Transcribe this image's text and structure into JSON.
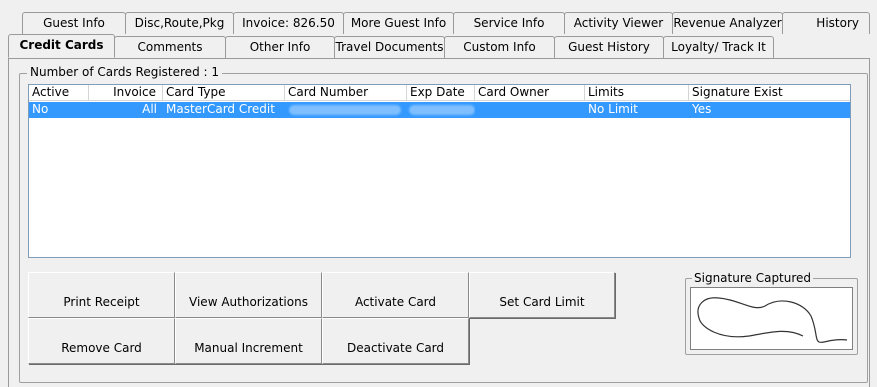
{
  "tabs_top": [
    "Guest Info",
    "Disc,Route,Pkg",
    "Invoice: 826.50",
    "More Guest Info",
    "Service Info",
    "Activity Viewer",
    "Revenue Analyzer",
    "History"
  ],
  "tabs_bottom": [
    "Credit Cards",
    "Comments",
    "Other Info",
    "Travel Documents",
    "Custom Info",
    "Guest History",
    "Loyalty/ Track It"
  ],
  "active_tab": "Credit Cards",
  "group_label": "Number of Cards Registered : 1",
  "table": {
    "columns": [
      "Active",
      "Invoice",
      "Card Type",
      "Card Number",
      "Exp Date",
      "Card Owner",
      "Limits",
      "Signature Exist"
    ],
    "rows": [
      [
        "No",
        "All",
        "MasterCard Credit",
        "",
        "",
        "",
        "No Limit",
        "Yes"
      ]
    ],
    "selected_row_color": "#3399ff"
  },
  "buttons": {
    "print_receipt": "Print Receipt",
    "view_authorizations": "View Authorizations",
    "activate_card": "Activate Card",
    "set_card_limit": "Set Card Limit",
    "remove_card": "Remove Card",
    "manual_increment": "Manual Increment",
    "deactivate_card": "Deactivate Card"
  },
  "signature": {
    "label": "Signature Captured"
  }
}
